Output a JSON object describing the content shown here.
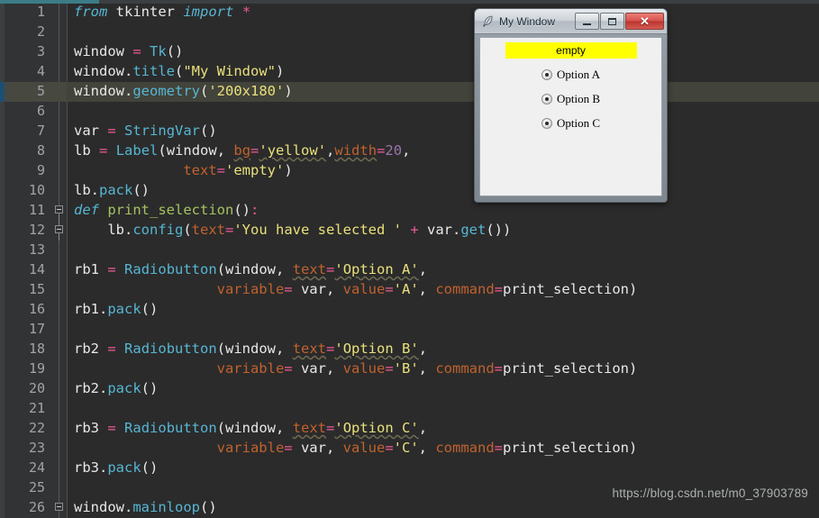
{
  "editor": {
    "language": "python",
    "theme": "darcula",
    "current_line": 5,
    "colors": {
      "background": "#2b2b2b",
      "gutter": "#313335",
      "current_line_highlight": "#42433a",
      "keyword": "#56b6d4",
      "string": "#e8e07a",
      "number": "#9876aa",
      "operator": "#ed5a97",
      "kwarg": "#c0622e",
      "function_def": "#a5c261",
      "text": "#e8e8e8"
    },
    "line_numbers": [
      1,
      2,
      3,
      4,
      5,
      6,
      7,
      8,
      9,
      10,
      11,
      12,
      13,
      14,
      15,
      16,
      17,
      18,
      19,
      20,
      21,
      22,
      23,
      24,
      25,
      26
    ],
    "lines": [
      {
        "n": 1,
        "tokens": [
          {
            "t": "from",
            "c": "kw"
          },
          {
            "t": " ",
            "c": "white"
          },
          {
            "t": "tkinter",
            "c": "white"
          },
          {
            "t": " ",
            "c": "white"
          },
          {
            "t": "import",
            "c": "kw"
          },
          {
            "t": " ",
            "c": "white"
          },
          {
            "t": "*",
            "c": "op"
          }
        ]
      },
      {
        "n": 2,
        "tokens": []
      },
      {
        "n": 3,
        "tokens": [
          {
            "t": "window",
            "c": "white"
          },
          {
            "t": " ",
            "c": "white"
          },
          {
            "t": "=",
            "c": "op"
          },
          {
            "t": " ",
            "c": "white"
          },
          {
            "t": "Tk",
            "c": "func"
          },
          {
            "t": "()",
            "c": "white"
          }
        ]
      },
      {
        "n": 4,
        "tokens": [
          {
            "t": "window.",
            "c": "white"
          },
          {
            "t": "title",
            "c": "func"
          },
          {
            "t": "(",
            "c": "white"
          },
          {
            "t": "\"My Window\"",
            "c": "str"
          },
          {
            "t": ")",
            "c": "white"
          }
        ]
      },
      {
        "n": 5,
        "tokens": [
          {
            "t": "window.",
            "c": "white"
          },
          {
            "t": "geometry",
            "c": "func"
          },
          {
            "t": "(",
            "c": "white"
          },
          {
            "t": "'200x180'",
            "c": "str"
          },
          {
            "t": ")",
            "c": "white"
          }
        ]
      },
      {
        "n": 6,
        "tokens": []
      },
      {
        "n": 7,
        "tokens": [
          {
            "t": "var",
            "c": "white"
          },
          {
            "t": " ",
            "c": "white"
          },
          {
            "t": "=",
            "c": "op"
          },
          {
            "t": " ",
            "c": "white"
          },
          {
            "t": "StringVar",
            "c": "func"
          },
          {
            "t": "()",
            "c": "white"
          }
        ]
      },
      {
        "n": 8,
        "tokens": [
          {
            "t": "lb",
            "c": "white"
          },
          {
            "t": " ",
            "c": "white"
          },
          {
            "t": "=",
            "c": "op"
          },
          {
            "t": " ",
            "c": "white"
          },
          {
            "t": "Label",
            "c": "func"
          },
          {
            "t": "(window, ",
            "c": "white"
          },
          {
            "t": "bg",
            "c": "kwarg"
          },
          {
            "t": "=",
            "c": "op"
          },
          {
            "t": "'yellow'",
            "c": "str"
          },
          {
            "t": ",",
            "c": "white"
          },
          {
            "t": "width",
            "c": "kwarg"
          },
          {
            "t": "=",
            "c": "op"
          },
          {
            "t": "20",
            "c": "num"
          },
          {
            "t": ",",
            "c": "white"
          }
        ]
      },
      {
        "n": 9,
        "tokens": [
          {
            "t": "             ",
            "c": "white"
          },
          {
            "t": "text",
            "c": "kwarg"
          },
          {
            "t": "=",
            "c": "op"
          },
          {
            "t": "'empty'",
            "c": "str"
          },
          {
            "t": ")",
            "c": "white"
          }
        ]
      },
      {
        "n": 10,
        "tokens": [
          {
            "t": "lb.",
            "c": "white"
          },
          {
            "t": "pack",
            "c": "func"
          },
          {
            "t": "()",
            "c": "white"
          }
        ]
      },
      {
        "n": 11,
        "tokens": [
          {
            "t": "def",
            "c": "kw"
          },
          {
            "t": " ",
            "c": "white"
          },
          {
            "t": "print_selection",
            "c": "def"
          },
          {
            "t": "()",
            "c": "white"
          },
          {
            "t": ":",
            "c": "op"
          }
        ]
      },
      {
        "n": 12,
        "tokens": [
          {
            "t": "    lb.",
            "c": "white"
          },
          {
            "t": "config",
            "c": "func"
          },
          {
            "t": "(",
            "c": "white"
          },
          {
            "t": "text",
            "c": "kwarg"
          },
          {
            "t": "=",
            "c": "op"
          },
          {
            "t": "'You have selected '",
            "c": "str"
          },
          {
            "t": " ",
            "c": "white"
          },
          {
            "t": "+",
            "c": "op"
          },
          {
            "t": " var.",
            "c": "white"
          },
          {
            "t": "get",
            "c": "func"
          },
          {
            "t": "())",
            "c": "white"
          }
        ]
      },
      {
        "n": 13,
        "tokens": []
      },
      {
        "n": 14,
        "tokens": [
          {
            "t": "rb1",
            "c": "white"
          },
          {
            "t": " ",
            "c": "white"
          },
          {
            "t": "=",
            "c": "op"
          },
          {
            "t": " ",
            "c": "white"
          },
          {
            "t": "Radiobutton",
            "c": "func"
          },
          {
            "t": "(window, ",
            "c": "white"
          },
          {
            "t": "text",
            "c": "kwarg"
          },
          {
            "t": "=",
            "c": "op"
          },
          {
            "t": "'Option A'",
            "c": "str"
          },
          {
            "t": ",",
            "c": "white"
          }
        ]
      },
      {
        "n": 15,
        "tokens": [
          {
            "t": "                 ",
            "c": "white"
          },
          {
            "t": "variable",
            "c": "kwarg"
          },
          {
            "t": "=",
            "c": "op"
          },
          {
            "t": " var, ",
            "c": "white"
          },
          {
            "t": "value",
            "c": "kwarg"
          },
          {
            "t": "=",
            "c": "op"
          },
          {
            "t": "'A'",
            "c": "str"
          },
          {
            "t": ", ",
            "c": "white"
          },
          {
            "t": "command",
            "c": "kwarg"
          },
          {
            "t": "=",
            "c": "op"
          },
          {
            "t": "print_selection)",
            "c": "white"
          }
        ]
      },
      {
        "n": 16,
        "tokens": [
          {
            "t": "rb1.",
            "c": "white"
          },
          {
            "t": "pack",
            "c": "func"
          },
          {
            "t": "()",
            "c": "white"
          }
        ]
      },
      {
        "n": 17,
        "tokens": []
      },
      {
        "n": 18,
        "tokens": [
          {
            "t": "rb2",
            "c": "white"
          },
          {
            "t": " ",
            "c": "white"
          },
          {
            "t": "=",
            "c": "op"
          },
          {
            "t": " ",
            "c": "white"
          },
          {
            "t": "Radiobutton",
            "c": "func"
          },
          {
            "t": "(window, ",
            "c": "white"
          },
          {
            "t": "text",
            "c": "kwarg"
          },
          {
            "t": "=",
            "c": "op"
          },
          {
            "t": "'Option B'",
            "c": "str"
          },
          {
            "t": ",",
            "c": "white"
          }
        ]
      },
      {
        "n": 19,
        "tokens": [
          {
            "t": "                 ",
            "c": "white"
          },
          {
            "t": "variable",
            "c": "kwarg"
          },
          {
            "t": "=",
            "c": "op"
          },
          {
            "t": " var, ",
            "c": "white"
          },
          {
            "t": "value",
            "c": "kwarg"
          },
          {
            "t": "=",
            "c": "op"
          },
          {
            "t": "'B'",
            "c": "str"
          },
          {
            "t": ", ",
            "c": "white"
          },
          {
            "t": "command",
            "c": "kwarg"
          },
          {
            "t": "=",
            "c": "op"
          },
          {
            "t": "print_selection)",
            "c": "white"
          }
        ]
      },
      {
        "n": 20,
        "tokens": [
          {
            "t": "rb2.",
            "c": "white"
          },
          {
            "t": "pack",
            "c": "func"
          },
          {
            "t": "()",
            "c": "white"
          }
        ]
      },
      {
        "n": 21,
        "tokens": []
      },
      {
        "n": 22,
        "tokens": [
          {
            "t": "rb3",
            "c": "white"
          },
          {
            "t": " ",
            "c": "white"
          },
          {
            "t": "=",
            "c": "op"
          },
          {
            "t": " ",
            "c": "white"
          },
          {
            "t": "Radiobutton",
            "c": "func"
          },
          {
            "t": "(window, ",
            "c": "white"
          },
          {
            "t": "text",
            "c": "kwarg"
          },
          {
            "t": "=",
            "c": "op"
          },
          {
            "t": "'Option C'",
            "c": "str"
          },
          {
            "t": ",",
            "c": "white"
          }
        ]
      },
      {
        "n": 23,
        "tokens": [
          {
            "t": "                 ",
            "c": "white"
          },
          {
            "t": "variable",
            "c": "kwarg"
          },
          {
            "t": "=",
            "c": "op"
          },
          {
            "t": " var, ",
            "c": "white"
          },
          {
            "t": "value",
            "c": "kwarg"
          },
          {
            "t": "=",
            "c": "op"
          },
          {
            "t": "'C'",
            "c": "str"
          },
          {
            "t": ", ",
            "c": "white"
          },
          {
            "t": "command",
            "c": "kwarg"
          },
          {
            "t": "=",
            "c": "op"
          },
          {
            "t": "print_selection)",
            "c": "white"
          }
        ]
      },
      {
        "n": 24,
        "tokens": [
          {
            "t": "rb3.",
            "c": "white"
          },
          {
            "t": "pack",
            "c": "func"
          },
          {
            "t": "()",
            "c": "white"
          }
        ]
      },
      {
        "n": 25,
        "tokens": []
      },
      {
        "n": 26,
        "tokens": [
          {
            "t": "window.",
            "c": "white"
          },
          {
            "t": "mainloop",
            "c": "func"
          },
          {
            "t": "()",
            "c": "white"
          }
        ]
      }
    ]
  },
  "tk_window": {
    "title": "My Window",
    "icon": "feather-icon",
    "buttons": {
      "minimize": "minimize-button",
      "maximize": "maximize-button",
      "close": "✕"
    },
    "label": {
      "text": "empty",
      "bg": "#ffff00",
      "fg": "#000000"
    },
    "radios": [
      {
        "label": "Option A",
        "value": "A"
      },
      {
        "label": "Option B",
        "value": "B"
      },
      {
        "label": "Option C",
        "value": "C"
      }
    ]
  },
  "watermark": {
    "text": "https://blog.csdn.net/m0_37903789"
  }
}
